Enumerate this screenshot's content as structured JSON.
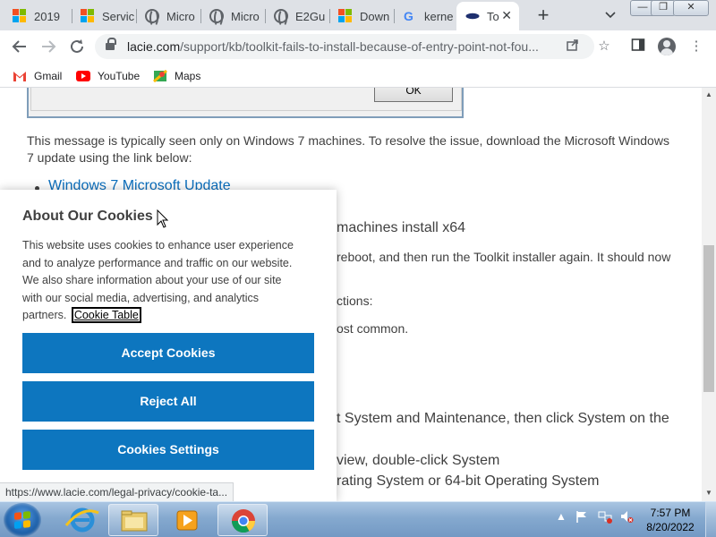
{
  "browser": {
    "tabs": [
      {
        "label": "2019",
        "icon": "microsoft-icon"
      },
      {
        "label": "Servic",
        "icon": "microsoft-icon"
      },
      {
        "label": "Micro",
        "icon": "globe-icon"
      },
      {
        "label": "Micro",
        "icon": "globe-icon"
      },
      {
        "label": "E2Gu",
        "icon": "globe-icon"
      },
      {
        "label": "Down",
        "icon": "microsoft-icon"
      },
      {
        "label": "kerne",
        "icon": "google-icon"
      },
      {
        "label": "To",
        "icon": "lacie-icon",
        "active": true
      }
    ],
    "window_controls": {
      "minimize": "—",
      "maximize": "❐",
      "close": "✕"
    },
    "url_main": "lacie.com",
    "url_rest": "/support/kb/toolkit-fails-to-install-because-of-entry-point-not-fou...",
    "bookmarks": [
      {
        "label": "Gmail",
        "icon": "gmail-icon"
      },
      {
        "label": "YouTube",
        "icon": "youtube-icon"
      },
      {
        "label": "Maps",
        "icon": "maps-icon"
      }
    ],
    "status_url": "https://www.lacie.com/legal-privacy/cookie-ta..."
  },
  "page": {
    "ok_label": "OK",
    "para1_line1": "This message is typically seen only on Windows 7 machines. To resolve the issue, download the Microsoft Windows",
    "para1_line2": "7 update using the link below:",
    "update_link": "Windows 7 Microsoft Update",
    "frag_machines": "machines install x64",
    "frag_reboot": "reboot, and then run the Toolkit installer again. It should now",
    "frag_instructions": "ctions:",
    "frag_common": "ost common.",
    "frag_system": "t System and Maintenance, then click System on the",
    "frag_view": "view, double-click System",
    "frag_operating": "rating System or 64-bit Operating System"
  },
  "cookie": {
    "title": "About Our Cookies",
    "body_lines": [
      "This website uses cookies to enhance user experience",
      "and to analyze performance and traffic on our website.",
      "We also share information about your use of our site",
      "with our social media, advertising, and analytics"
    ],
    "body_last": "partners.",
    "link": "Cookie Table",
    "accept": "Accept Cookies",
    "reject": "Reject All",
    "settings": "Cookies Settings",
    "button_color": "#0d76bf"
  },
  "taskbar": {
    "clock_time": "7:57 PM",
    "clock_date": "8/20/2022",
    "apps": [
      "internet-explorer-icon",
      "file-explorer-icon",
      "media-player-icon",
      "chrome-icon"
    ]
  }
}
